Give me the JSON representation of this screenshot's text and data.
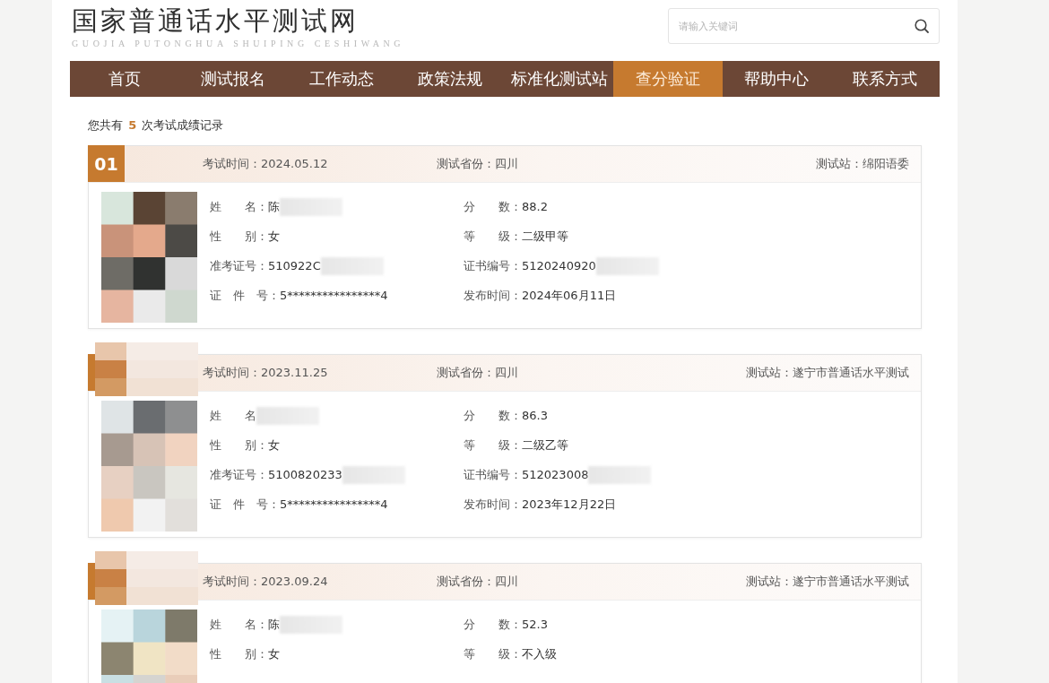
{
  "site": {
    "title": "国家普通话水平测试网",
    "subtitle": "GUOJIA PUTONGHUA SHUIPING CESHIWANG"
  },
  "search": {
    "placeholder": "请输入关键词"
  },
  "nav": [
    {
      "label": "首页",
      "selected": false
    },
    {
      "label": "测试报名",
      "selected": false
    },
    {
      "label": "工作动态",
      "selected": false
    },
    {
      "label": "政策法规",
      "selected": false
    },
    {
      "label": "标准化测试站",
      "selected": false
    },
    {
      "label": "查分验证",
      "selected": true
    },
    {
      "label": "帮助中心",
      "selected": false
    },
    {
      "label": "联系方式",
      "selected": false
    }
  ],
  "summary": "您共有 **5** 次考试成绩记录",
  "records": [
    {
      "badge": "01",
      "badge_covered": false,
      "exam_time": "考试时间：2024.05.12",
      "province": "测试省份：四川",
      "station": "测试站：绵阳语委",
      "left_fields": [
        {
          "label": "姓　　名：",
          "value": "陈",
          "blurred": true
        },
        {
          "label": "性　　别：",
          "value": "女",
          "blurred": false
        },
        {
          "label": "准考证号：",
          "value": "510922C",
          "blurred": true
        },
        {
          "label": "证　件　号：",
          "value": "5****************4",
          "blurred": false
        }
      ],
      "right_fields": [
        {
          "label": "分　　数：",
          "value": "88.2",
          "blurred": false
        },
        {
          "label": "等　　级：",
          "value": "二级甲等",
          "blurred": false
        },
        {
          "label": "证书编号：",
          "value": "5120240920",
          "blurred": true
        },
        {
          "label": "发布时间：",
          "value": "2024年06月11日",
          "blurred": false
        }
      ]
    },
    {
      "badge_covered": true,
      "exam_time": "考试时间：2023.11.25",
      "province": "测试省份：四川",
      "station": "测试站：遂宁市普通话水平测试",
      "left_fields": [
        {
          "label": "姓　　名",
          "blurred": true
        },
        {
          "label": "性　　别：",
          "value": "女",
          "blurred": false
        },
        {
          "label": "准考证号：",
          "value": "5100820233",
          "blurred": true
        },
        {
          "label": "证　件　号：",
          "value": "5****************4",
          "blurred": false
        }
      ],
      "right_fields": [
        {
          "label": "分　　数：",
          "value": "86.3",
          "blurred": false
        },
        {
          "label": "等　　级：",
          "value": "二级乙等",
          "blurred": false
        },
        {
          "label": "证书编号：",
          "value": "512023008",
          "blurred": true
        },
        {
          "label": "发布时间：",
          "value": "2023年12月22日",
          "blurred": false
        }
      ]
    },
    {
      "badge_covered": true,
      "exam_time": "考试时间：2023.09.24",
      "province": "测试省份：四川",
      "station": "测试站：遂宁市普通话水平测试",
      "left_fields": [
        {
          "label": "姓　　名：",
          "value": "陈",
          "blurred": true
        },
        {
          "label": "性　　别：",
          "value": "女",
          "blurred": false
        }
      ],
      "right_fields": [
        {
          "label": "分　　数：",
          "value": "52.3",
          "blurred": false
        },
        {
          "label": "等　　级：",
          "value": "不入级",
          "blurred": false
        }
      ]
    }
  ]
}
